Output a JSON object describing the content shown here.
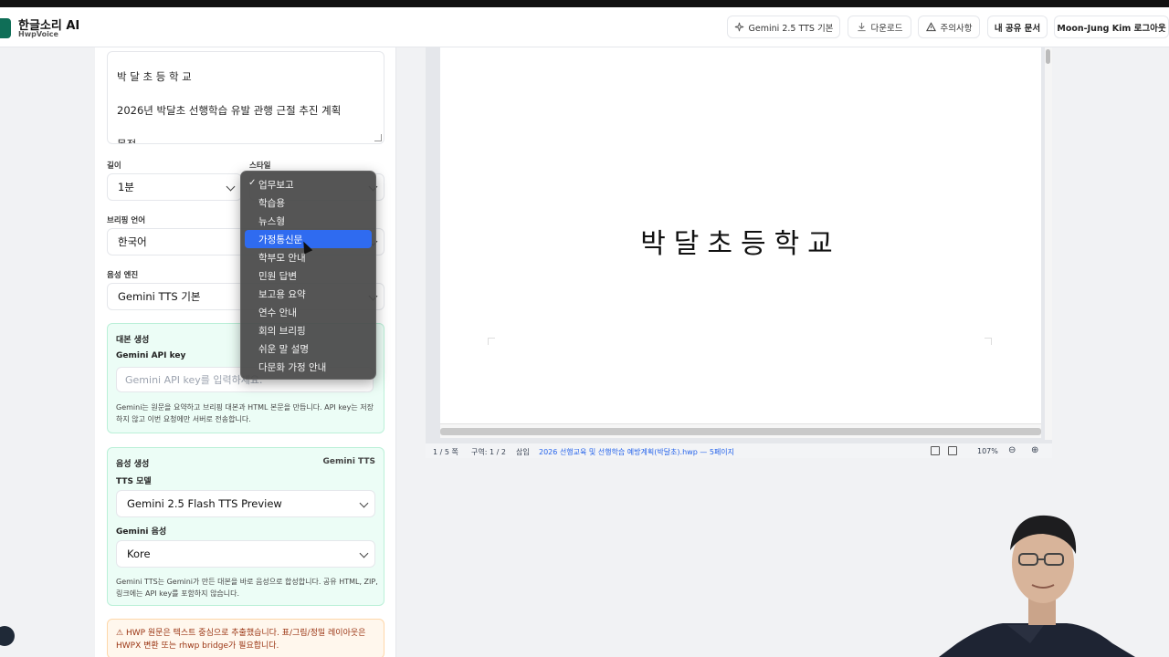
{
  "header": {
    "title": "한글소리 AI",
    "subtitle": "HwpVoice",
    "buttons": {
      "model": "Gemini 2.5 TTS 기본",
      "download": "다운로드",
      "caution": "주의사항",
      "shared": "내 공유 문서",
      "account": "Moon-Jung Kim 로그아웃"
    }
  },
  "editor": {
    "line1": "박 달 초 등 학 교",
    "line2": "2026년 박달초 선행학습 유발 관행 근절 추진 계획",
    "line3": "목적"
  },
  "form": {
    "length_label": "길이",
    "length_value": "1분",
    "style_label": "스타일",
    "lang_label": "브리핑 언어",
    "lang_value": "한국어",
    "engine_label": "음성 엔진",
    "engine_value": "Gemini TTS 기본"
  },
  "script_gen": {
    "title": "대본 생성",
    "key_label": "Gemini API key",
    "key_placeholder": "Gemini API key를 입력하세요.",
    "note": "Gemini는 원문을 요약하고 브리핑 대본과 HTML 본문을 만듭니다. API key는 저장하지 않고 이번 요청에만 서버로 전송합니다."
  },
  "voice_gen": {
    "title": "음성 생성",
    "badge": "Gemini TTS",
    "model_label": "TTS 모델",
    "model_value": "Gemini 2.5 Flash TTS Preview",
    "voice_label": "Gemini 음성",
    "voice_value": "Kore",
    "note": "Gemini TTS는 Gemini가 만든 대본을 바로 음성으로 합성합니다. 공유 HTML, ZIP, 링크에는 API key를 포함하지 않습니다."
  },
  "warning": {
    "line1": "HWP 원문은 텍스트 중심으로 추출했습니다. 표/그림/정밀 레이아웃은",
    "line2": "HWPX 변환 또는 rhwp bridge가 필요합니다."
  },
  "style_dropdown": {
    "items": [
      "업무보고",
      "학습용",
      "뉴스형",
      "가정통신문",
      "학부모 안내",
      "민원 답변",
      "보고용 요약",
      "연수 안내",
      "회의 브리핑",
      "쉬운 말 설명",
      "다문화 가정 안내"
    ],
    "checked_index": 0,
    "highlighted_index": 3
  },
  "viewer": {
    "doc_title": "박달초등학교",
    "status": {
      "page": "1 / 5 쪽",
      "section": "구역: 1 / 2",
      "mode": "삽입",
      "file": "2026 선행교육 및 선행학습 예방계획(박달초).hwp — 5페이지",
      "zoom": "107%"
    }
  },
  "colors": {
    "brand": "#0f6e57",
    "highlight": "#2f6bf0",
    "green_panel": "#ecfdf6",
    "warning": "#9a3412"
  }
}
